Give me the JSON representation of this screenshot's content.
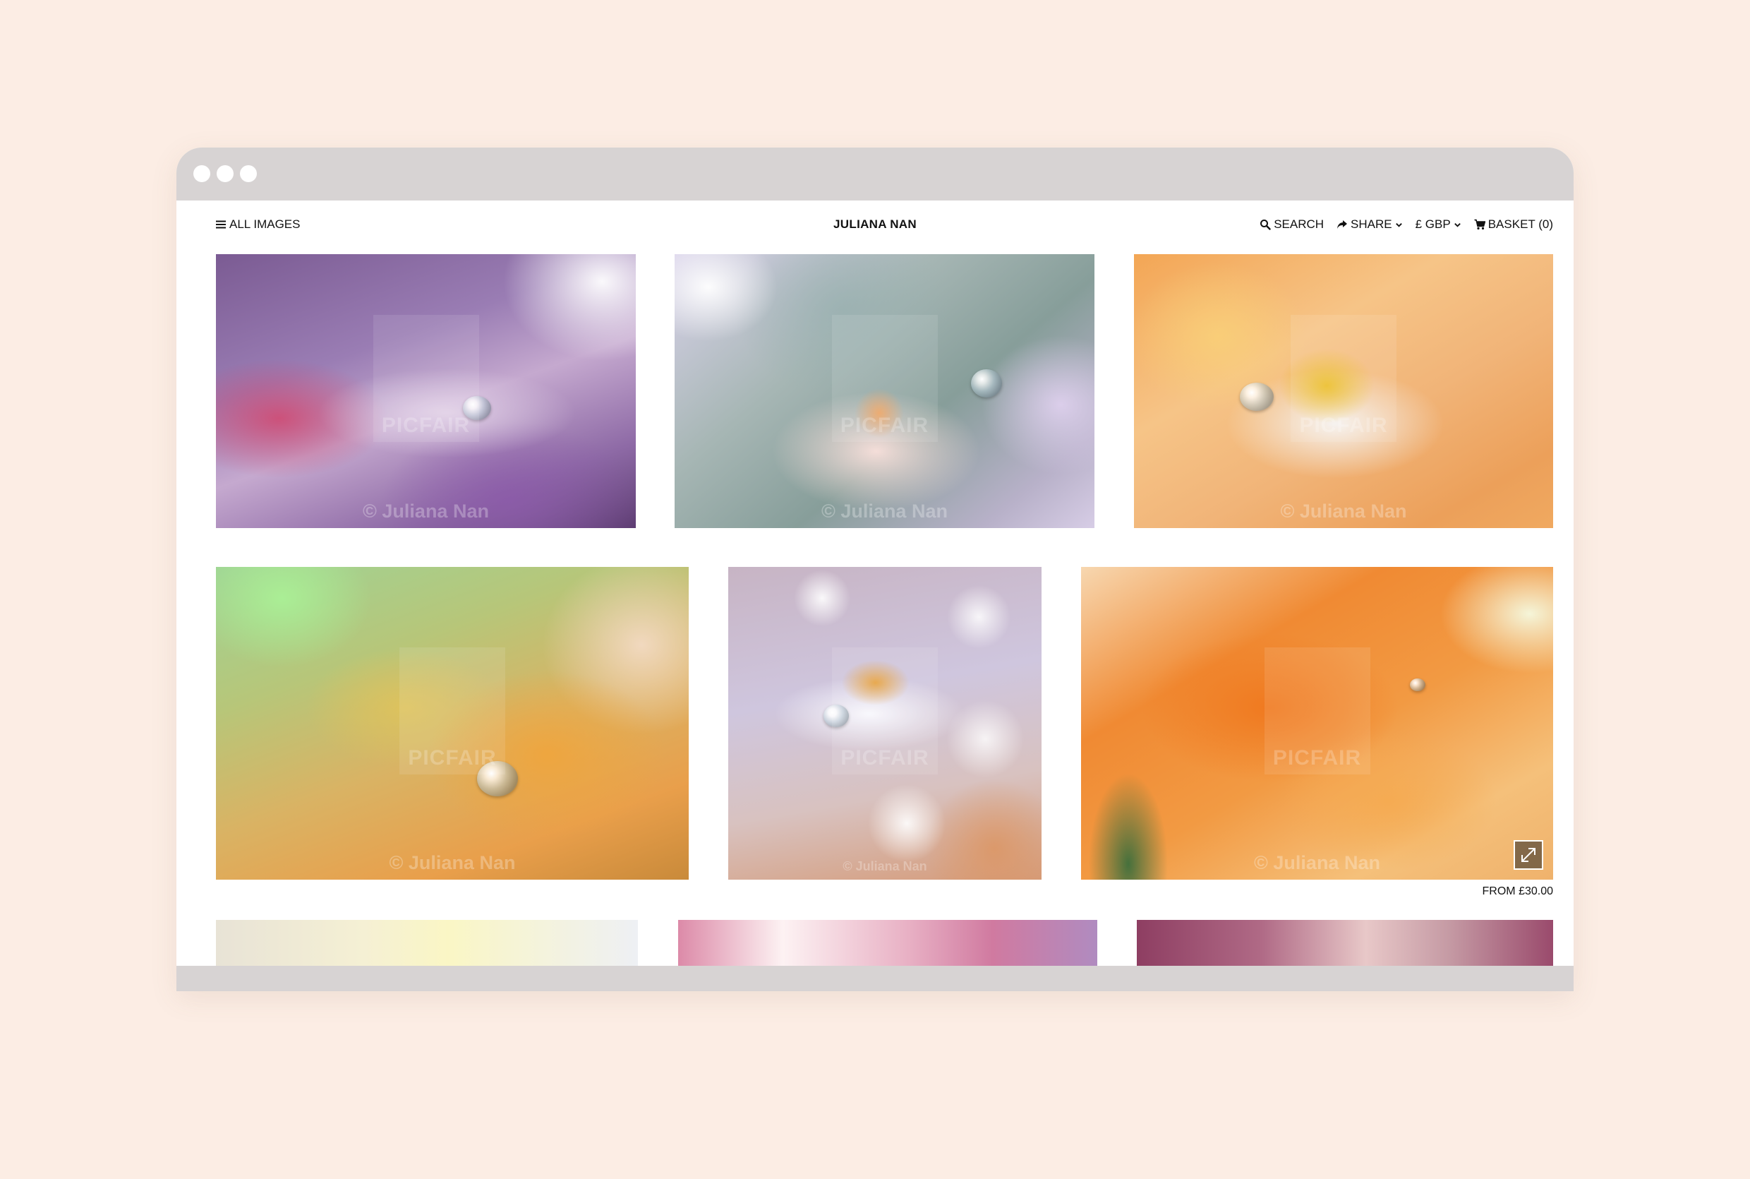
{
  "nav": {
    "all_images": "ALL IMAGES",
    "brand": "JULIANA NAN",
    "search": "SEARCH",
    "share": "SHARE",
    "currency": "£ GBP",
    "basket": "BASKET (0)"
  },
  "watermark": {
    "copyright": "© Juliana Nan",
    "brand": "PICFAIR"
  },
  "gallery": {
    "featured_price": "FROM £30.00"
  },
  "colors": {
    "page_background": "#fcede4",
    "window_chrome": "#d7d3d3"
  }
}
